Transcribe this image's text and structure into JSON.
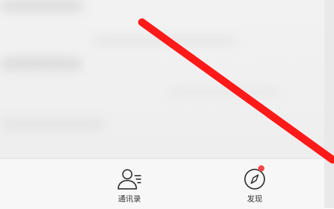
{
  "tab_bar": {
    "tabs": [
      {
        "label": "通讯录",
        "icon": "contacts-icon"
      },
      {
        "label": "发现",
        "icon": "discover-compass-icon"
      }
    ]
  },
  "colors": {
    "accent_red": "#f24747",
    "annotation_red": "#ff1a1a",
    "brand_green": "#07c160"
  }
}
